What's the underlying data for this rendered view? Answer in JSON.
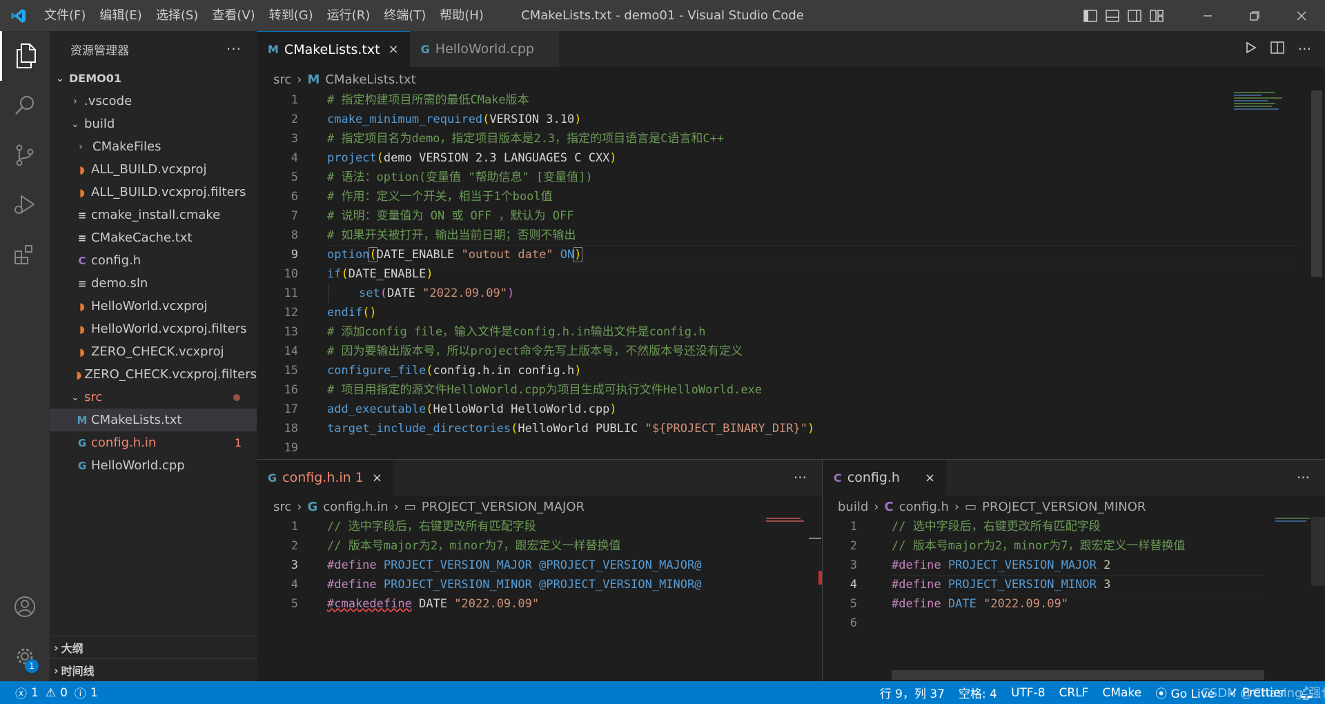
{
  "window": {
    "title": "CMakeLists.txt - demo01 - Visual Studio Code",
    "menu": [
      "文件(F)",
      "编辑(E)",
      "选择(S)",
      "查看(V)",
      "转到(G)",
      "运行(R)",
      "终端(T)",
      "帮助(H)"
    ]
  },
  "colors": {
    "accent": "#007acc",
    "titlebar": "#3c3c3c",
    "sidebar": "#252526",
    "editor": "#1e1e1e",
    "error": "#f48771",
    "modified": "#e2c08d"
  },
  "sidebar": {
    "title": "资源管理器",
    "more": "···",
    "root": "DEMO01",
    "items": [
      {
        "label": ".vscode"
      },
      {
        "label": "build"
      },
      {
        "label": "CMakeFiles"
      },
      {
        "label": "ALL_BUILD.vcxproj"
      },
      {
        "label": "ALL_BUILD.vcxproj.filters"
      },
      {
        "label": "cmake_install.cmake"
      },
      {
        "label": "CMakeCache.txt"
      },
      {
        "label": "config.h"
      },
      {
        "label": "demo.sln"
      },
      {
        "label": "HelloWorld.vcxproj"
      },
      {
        "label": "HelloWorld.vcxproj.filters"
      },
      {
        "label": "ZERO_CHECK.vcxproj"
      },
      {
        "label": "ZERO_CHECK.vcxproj.filters"
      },
      {
        "label": "src"
      },
      {
        "label": "CMakeLists.txt"
      },
      {
        "label": "config.h.in",
        "badge": "1"
      },
      {
        "label": "HelloWorld.cpp"
      }
    ],
    "outline": "大纲",
    "timeline": "时间线"
  },
  "activity": {
    "settings_badge": "1"
  },
  "top_editor": {
    "tabs": [
      {
        "label": "CMakeLists.txt",
        "icon": "M",
        "close": "×"
      },
      {
        "label": "HelloWorld.cpp",
        "icon": "G"
      }
    ],
    "breadcrumb": [
      "src",
      "CMakeLists.txt"
    ],
    "line_numbers": [
      "1",
      "2",
      "3",
      "4",
      "5",
      "6",
      "7",
      "8",
      "9",
      "10",
      "11",
      "12",
      "13",
      "14",
      "15",
      "16",
      "17",
      "18",
      "19"
    ],
    "lines": {
      "l1": "# 指定构建项目所需的最低CMake版本",
      "l2_fn": "cmake_minimum_required",
      "l2_args": "VERSION 3.10",
      "l3": "# 指定项目名为demo，指定项目版本是2.3，指定的项目语言是C语言和C++",
      "l4_fn": "project",
      "l4_args": "demo VERSION 2.3 LANGUAGES C CXX",
      "l5": "# 语法：option(变量值 \"帮助信息\" [变量值])",
      "l6": "# 作用：定义一个开关，相当于1个bool值",
      "l7": "# 说明：变量值为 ON 或 OFF ，默认为 OFF",
      "l8": "# 如果开关被打开，输出当前日期；否则不输出",
      "l9_fn": "option",
      "l9_a": "DATE_ENABLE ",
      "l9_s": "\"outout date\"",
      "l9_k": " ON",
      "l10_fn": "if",
      "l10_args": "DATE_ENABLE",
      "l11_fn": "set",
      "l11_a": "DATE ",
      "l11_s": "\"2022.09.09\"",
      "l12_fn": "endif",
      "l13": "# 添加config file，输入文件是config.h.in输出文件是config.h",
      "l14": "# 因为要输出版本号，所以project命令先写上版本号，不然版本号还没有定义",
      "l15_fn": "configure_file",
      "l15_args": "config.h.in config.h",
      "l16": "# 项目用指定的源文件HelloWorld.cpp为项目生成可执行文件HelloWorld.exe",
      "l17_fn": "add_executable",
      "l17_args": "HelloWorld HelloWorld.cpp",
      "l18_fn": "target_include_directories",
      "l18_a": "HelloWorld PUBLIC ",
      "l18_s": "\"${PROJECT_BINARY_DIR}\""
    }
  },
  "left_editor": {
    "tab": {
      "label": "config.h.in 1",
      "close": "×"
    },
    "more": "···",
    "breadcrumb": [
      "src",
      "config.h.in",
      "PROJECT_VERSION_MAJOR"
    ],
    "line_numbers": [
      "1",
      "2",
      "3",
      "4",
      "5"
    ],
    "lines": {
      "l1": "// 选中字段后，右键更改所有匹配字段",
      "l2": "// 版本号major为2，minor为7，跟宏定义一样替换值",
      "pp": "#define",
      "l3_m": "PROJECT_VERSION_MAJOR",
      "l3_v": "@PROJECT_VERSION_MAJOR@",
      "l4_m": "PROJECT_VERSION_MINOR",
      "l4_v": "@PROJECT_VERSION_MINOR@",
      "l5_pp": "#cmakedefine",
      "l5_m": "DATE",
      "l5_s": "\"2022.09.09\""
    }
  },
  "right_editor": {
    "tab": {
      "label": "config.h",
      "close": "×"
    },
    "more": "···",
    "breadcrumb": [
      "build",
      "config.h",
      "PROJECT_VERSION_MINOR"
    ],
    "line_numbers": [
      "1",
      "2",
      "3",
      "4",
      "5",
      "6"
    ],
    "lines": {
      "l1": "// 选中字段后，右键更改所有匹配字段",
      "l2": "// 版本号major为2，minor为7，跟宏定义一样替换值",
      "pp": "#define",
      "l3_m": "PROJECT_VERSION_MAJOR",
      "l3_v": "2",
      "l4_m": "PROJECT_VERSION_MINOR",
      "l4_v": "3",
      "l5_m": "DATE",
      "l5_s": "\"2022.09.09\""
    }
  },
  "statusbar": {
    "errors": "1",
    "warnings": "0",
    "info": "1",
    "position": "行 9，列 37",
    "spaces": "空格: 4",
    "encoding": "UTF-8",
    "eol": "CRLF",
    "language": "CMake",
    "golive": "Go Live",
    "prettier": "Prettier",
    "watermark": "CSDN @Chasing_强化"
  }
}
